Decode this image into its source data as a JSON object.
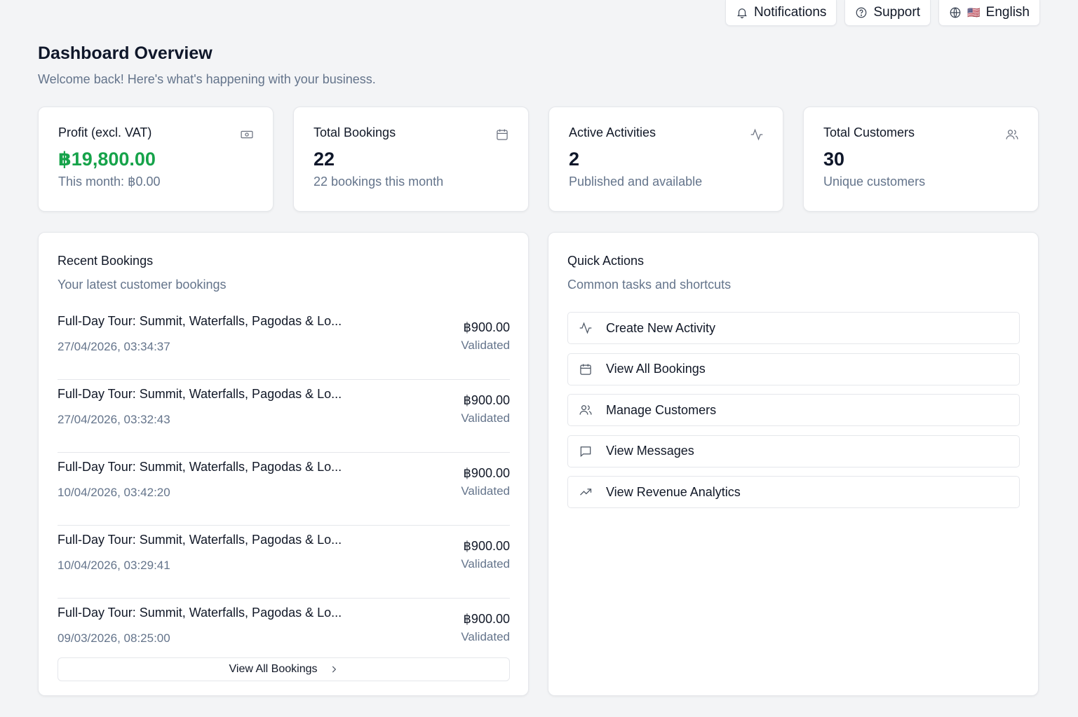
{
  "topbar": {
    "notifications_label": "Notifications",
    "support_label": "Support",
    "language_flag": "🇺🇸",
    "language_label": "English"
  },
  "header": {
    "title": "Dashboard Overview",
    "subtitle": "Welcome back! Here's what's happening with your business."
  },
  "stats": [
    {
      "label": "Profit (excl. VAT)",
      "value": "฿19,800.00",
      "note": "This month: ฿0.00",
      "icon": "banknote-icon"
    },
    {
      "label": "Total Bookings",
      "value": "22",
      "note": "22 bookings this month",
      "icon": "calendar-icon"
    },
    {
      "label": "Active Activities",
      "value": "2",
      "note": "Published and available",
      "icon": "activity-icon"
    },
    {
      "label": "Total Customers",
      "value": "30",
      "note": "Unique customers",
      "icon": "users-icon"
    }
  ],
  "recent_bookings": {
    "title": "Recent Bookings",
    "subtitle": "Your latest customer bookings",
    "items": [
      {
        "title": "Full-Day Tour: Summit, Waterfalls, Pagodas & Lo...",
        "date": "27/04/2026, 03:34:37",
        "amount": "฿900.00",
        "status": "Validated"
      },
      {
        "title": "Full-Day Tour: Summit, Waterfalls, Pagodas & Lo...",
        "date": "27/04/2026, 03:32:43",
        "amount": "฿900.00",
        "status": "Validated"
      },
      {
        "title": "Full-Day Tour: Summit, Waterfalls, Pagodas & Lo...",
        "date": "10/04/2026, 03:42:20",
        "amount": "฿900.00",
        "status": "Validated"
      },
      {
        "title": "Full-Day Tour: Summit, Waterfalls, Pagodas & Lo...",
        "date": "10/04/2026, 03:29:41",
        "amount": "฿900.00",
        "status": "Validated"
      },
      {
        "title": "Full-Day Tour: Summit, Waterfalls, Pagodas & Lo...",
        "date": "09/03/2026, 08:25:00",
        "amount": "฿900.00",
        "status": "Validated"
      }
    ],
    "view_all_label": "View All Bookings"
  },
  "quick_actions": {
    "title": "Quick Actions",
    "subtitle": "Common tasks and shortcuts",
    "items": [
      {
        "label": "Create New Activity",
        "icon": "activity-icon"
      },
      {
        "label": "View All Bookings",
        "icon": "calendar-icon"
      },
      {
        "label": "Manage Customers",
        "icon": "users-icon"
      },
      {
        "label": "View Messages",
        "icon": "message-icon"
      },
      {
        "label": "View Revenue Analytics",
        "icon": "trending-up-icon"
      }
    ]
  },
  "colors": {
    "profit_green": "#16a34a",
    "muted_text": "#64748b",
    "page_bg": "#f3f4f6"
  }
}
